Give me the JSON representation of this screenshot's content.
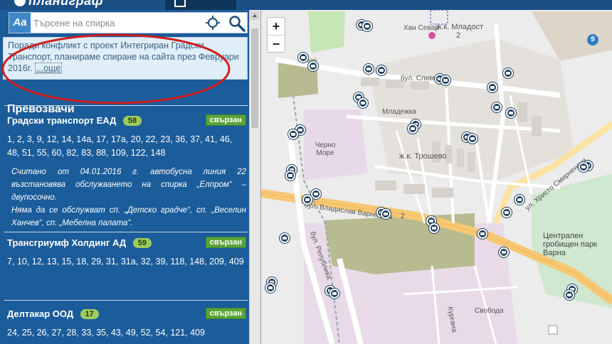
{
  "app": {
    "logo_text": "планиграф"
  },
  "search": {
    "aa_label": "Aa",
    "placeholder": "Търсене на спирка"
  },
  "notice": {
    "text": "Поради конфликт с проект Интегриран Градски Транспорт, планираме спиране на сайта през Февруари 2016г.",
    "more_label": "...още"
  },
  "section_title": "Превозвачи",
  "operators": [
    {
      "name": "Градски транспорт ЕАД",
      "count": "58",
      "status": "свързан",
      "lines": "1, 2, 3, 9, 12, 14, 14а, 17, 17а, 20, 22, 23, 36, 37, 41, 46, 48, 51, 55, 60, 82, 83, 88, 109, 122, 148",
      "note1": "Считано от 04.01.2016 г. автобусна линия 22 възстановява обслужването на спирка „Елпром“ – двупосочно.",
      "note2": "Няма да се обслужват сп. „Детско градче“, сп. „Веселин Ханчев“, сп. „Мебелна палата“."
    },
    {
      "name": "Трансгриумф Холдинг АД",
      "count": "59",
      "status": "свързан",
      "lines": "7, 10, 12, 13, 15, 18, 29, 31, 31а, 32, 39, 118, 148, 209, 409"
    },
    {
      "name": "Делтакар ООД",
      "count": "17",
      "status": "свързан",
      "lines": "24, 25, 26, 27, 28, 33, 35, 43, 49, 52, 54, 121, 409"
    }
  ],
  "map": {
    "zoom_in": "+",
    "zoom_out": "−",
    "labels": {
      "mladost": "ж.к. Младост",
      "mladost_num": "2",
      "han_sevar": "Хан Севар",
      "sliven": "бул. Сливница",
      "mladezhka": "Младежка",
      "trushevo": "ж.к. Трошево",
      "cherno_more": "Черно Море",
      "vladislav": "бул. Владислав Варненчик",
      "vl_num": "2",
      "republika": "бул. Република",
      "tsentralen": "Централен гробищен парк Варна",
      "smirnenski": "ул. Христо Смирненски",
      "svoboda": "Свобода",
      "kurtovich": "Кургана",
      "varna_num": "9"
    }
  }
}
